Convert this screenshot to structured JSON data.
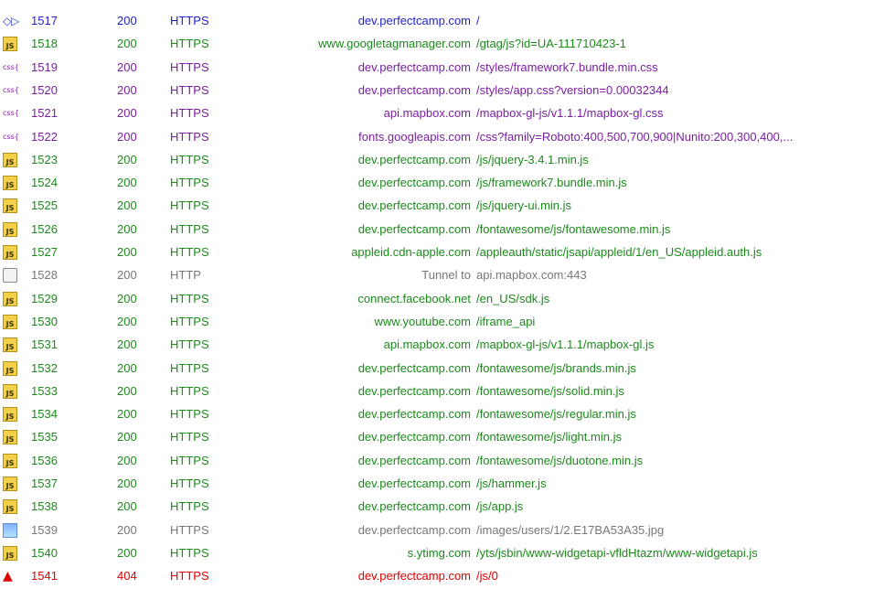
{
  "rows": [
    {
      "icon": "arrows-icon",
      "num": "1517",
      "result": "200",
      "protocol": "HTTPS",
      "host": "dev.perfectcamp.com",
      "url": "/",
      "color": "blue"
    },
    {
      "icon": "js-icon",
      "num": "1518",
      "result": "200",
      "protocol": "HTTPS",
      "host": "www.googletagmanager.com",
      "url": "/gtag/js?id=UA-111710423-1",
      "color": "green"
    },
    {
      "icon": "css-icon",
      "num": "1519",
      "result": "200",
      "protocol": "HTTPS",
      "host": "dev.perfectcamp.com",
      "url": "/styles/framework7.bundle.min.css",
      "color": "purple"
    },
    {
      "icon": "css-icon",
      "num": "1520",
      "result": "200",
      "protocol": "HTTPS",
      "host": "dev.perfectcamp.com",
      "url": "/styles/app.css?version=0.00032344",
      "color": "purple"
    },
    {
      "icon": "css-icon",
      "num": "1521",
      "result": "200",
      "protocol": "HTTPS",
      "host": "api.mapbox.com",
      "url": "/mapbox-gl-js/v1.1.1/mapbox-gl.css",
      "color": "purple"
    },
    {
      "icon": "css-icon",
      "num": "1522",
      "result": "200",
      "protocol": "HTTPS",
      "host": "fonts.googleapis.com",
      "url": "/css?family=Roboto:400,500,700,900|Nunito:200,300,400,...",
      "color": "purple"
    },
    {
      "icon": "js-icon",
      "num": "1523",
      "result": "200",
      "protocol": "HTTPS",
      "host": "dev.perfectcamp.com",
      "url": "/js/jquery-3.4.1.min.js",
      "color": "green"
    },
    {
      "icon": "js-icon",
      "num": "1524",
      "result": "200",
      "protocol": "HTTPS",
      "host": "dev.perfectcamp.com",
      "url": "/js/framework7.bundle.min.js",
      "color": "green"
    },
    {
      "icon": "js-icon",
      "num": "1525",
      "result": "200",
      "protocol": "HTTPS",
      "host": "dev.perfectcamp.com",
      "url": "/js/jquery-ui.min.js",
      "color": "green"
    },
    {
      "icon": "js-icon",
      "num": "1526",
      "result": "200",
      "protocol": "HTTPS",
      "host": "dev.perfectcamp.com",
      "url": "/fontawesome/js/fontawesome.min.js",
      "color": "green"
    },
    {
      "icon": "js-icon",
      "num": "1527",
      "result": "200",
      "protocol": "HTTPS",
      "host": "appleid.cdn-apple.com",
      "url": "/appleauth/static/jsapi/appleid/1/en_US/appleid.auth.js",
      "color": "green"
    },
    {
      "icon": "lock-icon",
      "num": "1528",
      "result": "200",
      "protocol": "HTTP",
      "host": "Tunnel to",
      "url": "api.mapbox.com:443",
      "color": "gray"
    },
    {
      "icon": "js-icon",
      "num": "1529",
      "result": "200",
      "protocol": "HTTPS",
      "host": "connect.facebook.net",
      "url": "/en_US/sdk.js",
      "color": "green"
    },
    {
      "icon": "js-icon",
      "num": "1530",
      "result": "200",
      "protocol": "HTTPS",
      "host": "www.youtube.com",
      "url": "/iframe_api",
      "color": "green"
    },
    {
      "icon": "js-icon",
      "num": "1531",
      "result": "200",
      "protocol": "HTTPS",
      "host": "api.mapbox.com",
      "url": "/mapbox-gl-js/v1.1.1/mapbox-gl.js",
      "color": "green"
    },
    {
      "icon": "js-icon",
      "num": "1532",
      "result": "200",
      "protocol": "HTTPS",
      "host": "dev.perfectcamp.com",
      "url": "/fontawesome/js/brands.min.js",
      "color": "green"
    },
    {
      "icon": "js-icon",
      "num": "1533",
      "result": "200",
      "protocol": "HTTPS",
      "host": "dev.perfectcamp.com",
      "url": "/fontawesome/js/solid.min.js",
      "color": "green"
    },
    {
      "icon": "js-icon",
      "num": "1534",
      "result": "200",
      "protocol": "HTTPS",
      "host": "dev.perfectcamp.com",
      "url": "/fontawesome/js/regular.min.js",
      "color": "green"
    },
    {
      "icon": "js-icon",
      "num": "1535",
      "result": "200",
      "protocol": "HTTPS",
      "host": "dev.perfectcamp.com",
      "url": "/fontawesome/js/light.min.js",
      "color": "green"
    },
    {
      "icon": "js-icon",
      "num": "1536",
      "result": "200",
      "protocol": "HTTPS",
      "host": "dev.perfectcamp.com",
      "url": "/fontawesome/js/duotone.min.js",
      "color": "green"
    },
    {
      "icon": "js-icon",
      "num": "1537",
      "result": "200",
      "protocol": "HTTPS",
      "host": "dev.perfectcamp.com",
      "url": "/js/hammer.js",
      "color": "green"
    },
    {
      "icon": "js-icon",
      "num": "1538",
      "result": "200",
      "protocol": "HTTPS",
      "host": "dev.perfectcamp.com",
      "url": "/js/app.js",
      "color": "green"
    },
    {
      "icon": "image-icon",
      "num": "1539",
      "result": "200",
      "protocol": "HTTPS",
      "host": "dev.perfectcamp.com",
      "url": "/images/users/1/2.E17BA53A35.jpg",
      "color": "gray"
    },
    {
      "icon": "js-icon",
      "num": "1540",
      "result": "200",
      "protocol": "HTTPS",
      "host": "s.ytimg.com",
      "url": "/yts/jsbin/www-widgetapi-vfldHtazm/www-widgetapi.js",
      "color": "green"
    },
    {
      "icon": "warning-icon",
      "num": "1541",
      "result": "404",
      "protocol": "HTTPS",
      "host": "dev.perfectcamp.com",
      "url": "/js/0",
      "color": "red"
    }
  ]
}
